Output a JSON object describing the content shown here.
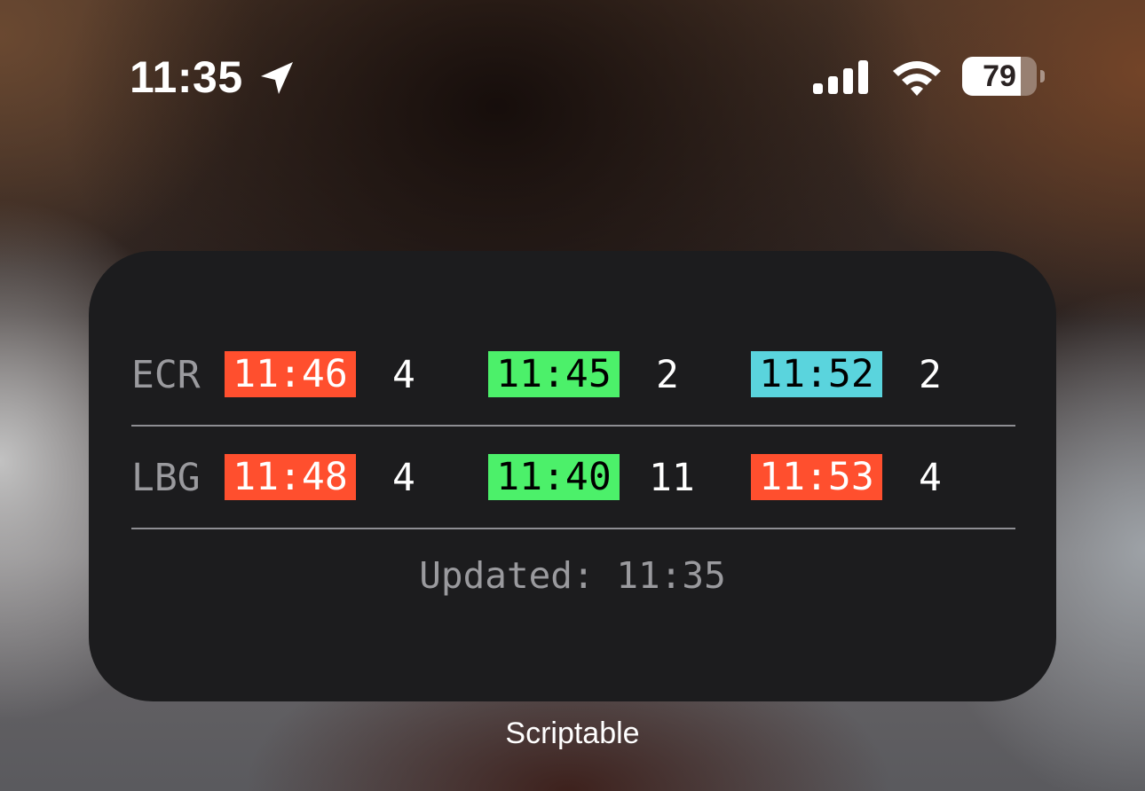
{
  "status_bar": {
    "time": "11:35",
    "location_icon": "location-arrow-icon",
    "signal_icon": "cellular-signal-icon",
    "wifi_icon": "wifi-icon",
    "battery_percent": "79",
    "battery_level": 0.79
  },
  "widget": {
    "rows": [
      {
        "station": "ECR",
        "departures": [
          {
            "time": "11:46",
            "count": "4",
            "chip_color": "#ff4f2e",
            "text_color": "#ffffff"
          },
          {
            "time": "11:45",
            "count": "2",
            "chip_color": "#4cf06a",
            "text_color": "#000000"
          },
          {
            "time": "11:52",
            "count": "2",
            "chip_color": "#5ad4dd",
            "text_color": "#000000"
          }
        ]
      },
      {
        "station": "LBG",
        "departures": [
          {
            "time": "11:48",
            "count": "4",
            "chip_color": "#ff4f2e",
            "text_color": "#ffffff"
          },
          {
            "time": "11:40",
            "count": "11",
            "chip_color": "#4cf06a",
            "text_color": "#000000"
          },
          {
            "time": "11:53",
            "count": "4",
            "chip_color": "#ff4f2e",
            "text_color": "#ffffff"
          }
        ]
      }
    ],
    "updated_text": "Updated: 11:35"
  },
  "app_label": "Scriptable"
}
